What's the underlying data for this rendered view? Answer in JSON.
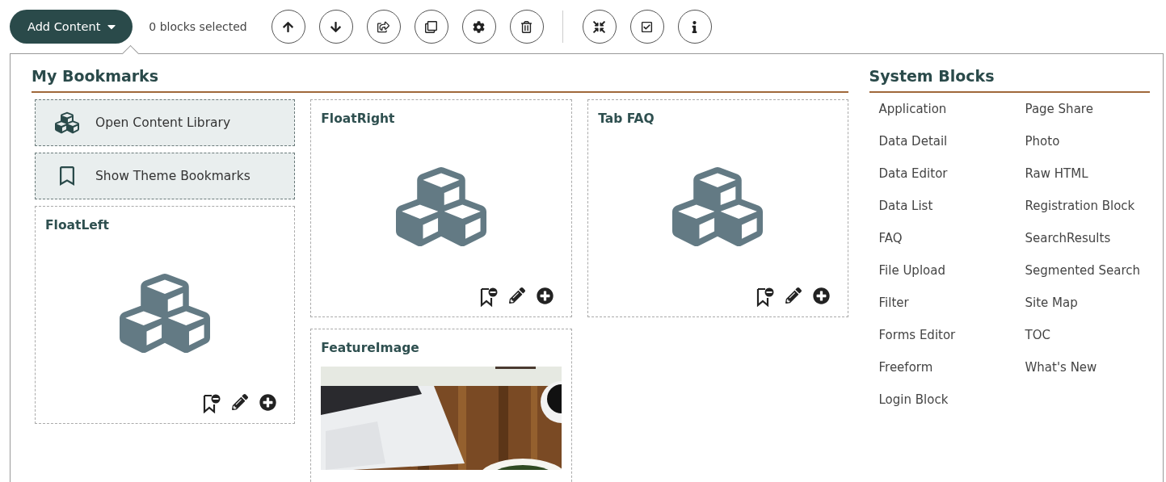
{
  "toolbar": {
    "add_button": "Add Content",
    "selection_count": "0 blocks selected"
  },
  "bookmarks": {
    "title": "My Bookmarks",
    "actions": [
      {
        "kind": "library",
        "label": "Open Content Library"
      },
      {
        "kind": "theme",
        "label": "Show Theme Bookmarks"
      }
    ],
    "cards": [
      {
        "kind": "block",
        "title": "FloatLeft"
      },
      {
        "kind": "block",
        "title": "FloatRight"
      },
      {
        "kind": "block",
        "title": "Tab FAQ"
      },
      {
        "kind": "picture",
        "title": "FeatureImage"
      }
    ]
  },
  "system_blocks": {
    "title": "System Blocks",
    "items": [
      "Application",
      "Data Detail",
      "Data Editor",
      "Data List",
      "FAQ",
      "File Upload",
      "Filter",
      "Forms Editor",
      "Freeform",
      "Login Block",
      "Page Share",
      "Photo",
      "Raw HTML",
      "Registration Block",
      "SearchResults",
      "Segmented Search",
      "Site Map",
      "TOC",
      "What's New"
    ]
  }
}
